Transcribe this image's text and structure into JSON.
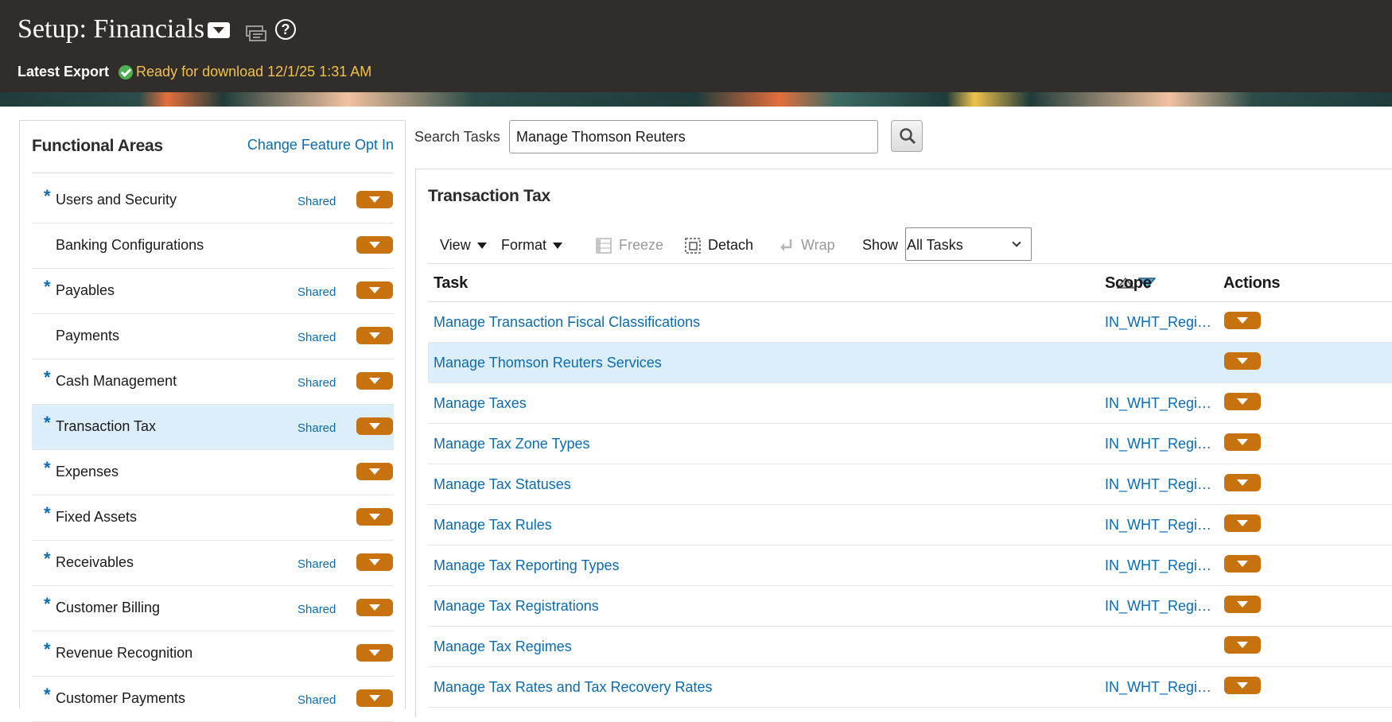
{
  "header": {
    "title": "Setup: Financials",
    "latest_export_label": "Latest Export",
    "export_status": "Ready for download 12/1/25 1:31 AM"
  },
  "left": {
    "title": "Functional Areas",
    "link": "Change Feature Opt In",
    "items": [
      {
        "label": "Users and Security",
        "required": true,
        "shared": "Shared"
      },
      {
        "label": "Banking Configurations",
        "required": false,
        "shared": ""
      },
      {
        "label": "Payables",
        "required": true,
        "shared": "Shared"
      },
      {
        "label": "Payments",
        "required": false,
        "shared": "Shared"
      },
      {
        "label": "Cash Management",
        "required": true,
        "shared": "Shared"
      },
      {
        "label": "Transaction Tax",
        "required": true,
        "shared": "Shared",
        "selected": true
      },
      {
        "label": "Expenses",
        "required": true,
        "shared": ""
      },
      {
        "label": "Fixed Assets",
        "required": true,
        "shared": ""
      },
      {
        "label": "Receivables",
        "required": true,
        "shared": "Shared"
      },
      {
        "label": "Customer Billing",
        "required": true,
        "shared": "Shared"
      },
      {
        "label": "Revenue Recognition",
        "required": true,
        "shared": ""
      },
      {
        "label": "Customer Payments",
        "required": true,
        "shared": "Shared"
      }
    ]
  },
  "search": {
    "label": "Search Tasks",
    "value": "Manage Thomson Reuters"
  },
  "main": {
    "title": "Transaction Tax",
    "toolbar": {
      "view": "View",
      "format": "Format",
      "freeze": "Freeze",
      "detach": "Detach",
      "wrap": "Wrap",
      "show": "Show",
      "show_value": "All Tasks"
    },
    "columns": {
      "task": "Task",
      "scope": "Scope",
      "actions": "Actions"
    },
    "rows": [
      {
        "task": "Manage Transaction Fiscal Classifications",
        "scope": "IN_WHT_Regim…"
      },
      {
        "task": "Manage Thomson Reuters Services",
        "scope": "",
        "selected": true
      },
      {
        "task": "Manage Taxes",
        "scope": "IN_WHT_Regim…"
      },
      {
        "task": "Manage Tax Zone Types",
        "scope": "IN_WHT_Regim…"
      },
      {
        "task": "Manage Tax Statuses",
        "scope": "IN_WHT_Regim…"
      },
      {
        "task": "Manage Tax Rules",
        "scope": "IN_WHT_Regim…"
      },
      {
        "task": "Manage Tax Reporting Types",
        "scope": "IN_WHT_Regim…"
      },
      {
        "task": "Manage Tax Registrations",
        "scope": "IN_WHT_Regim…"
      },
      {
        "task": "Manage Tax Regimes",
        "scope": ""
      },
      {
        "task": "Manage Tax Rates and Tax Recovery Rates",
        "scope": "IN_WHT_Regim…"
      }
    ]
  },
  "colors": {
    "header_bg": "#312d2a",
    "link": "#0b6bb0",
    "action_button": "#c7720e",
    "selected_row": "#ddeefb",
    "export_status": "#f0c24b"
  }
}
